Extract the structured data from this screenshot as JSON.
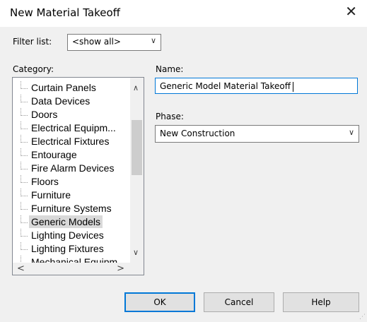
{
  "dialog": {
    "title": "New Material Takeoff",
    "close_glyph": "✕"
  },
  "filter": {
    "label": "Filter list:",
    "value": "<show all>"
  },
  "category": {
    "label": "Category:",
    "items": [
      "Curtain Panels",
      "Data Devices",
      "Doors",
      "Electrical Equipm...",
      "Electrical Fixtures",
      "Entourage",
      "Fire Alarm Devices",
      "Floors",
      "Furniture",
      "Furniture Systems",
      "Generic Models",
      "Lighting Devices",
      "Lighting Fixtures",
      "Mechanical Equipm..."
    ],
    "selected_index": 10
  },
  "name_field": {
    "label": "Name:",
    "value": "Generic Model Material Takeoff"
  },
  "phase": {
    "label": "Phase:",
    "value": "New Construction"
  },
  "buttons": {
    "ok": "OK",
    "cancel": "Cancel",
    "help": "Help"
  },
  "icons": {
    "chevron_down": "∨",
    "scroll_up": "∧",
    "scroll_down": "∨",
    "scroll_left": "<",
    "scroll_right": ">"
  },
  "colors": {
    "accent": "#0078d7",
    "selection": "#d9d9d9",
    "background": "#f0f0f0"
  }
}
